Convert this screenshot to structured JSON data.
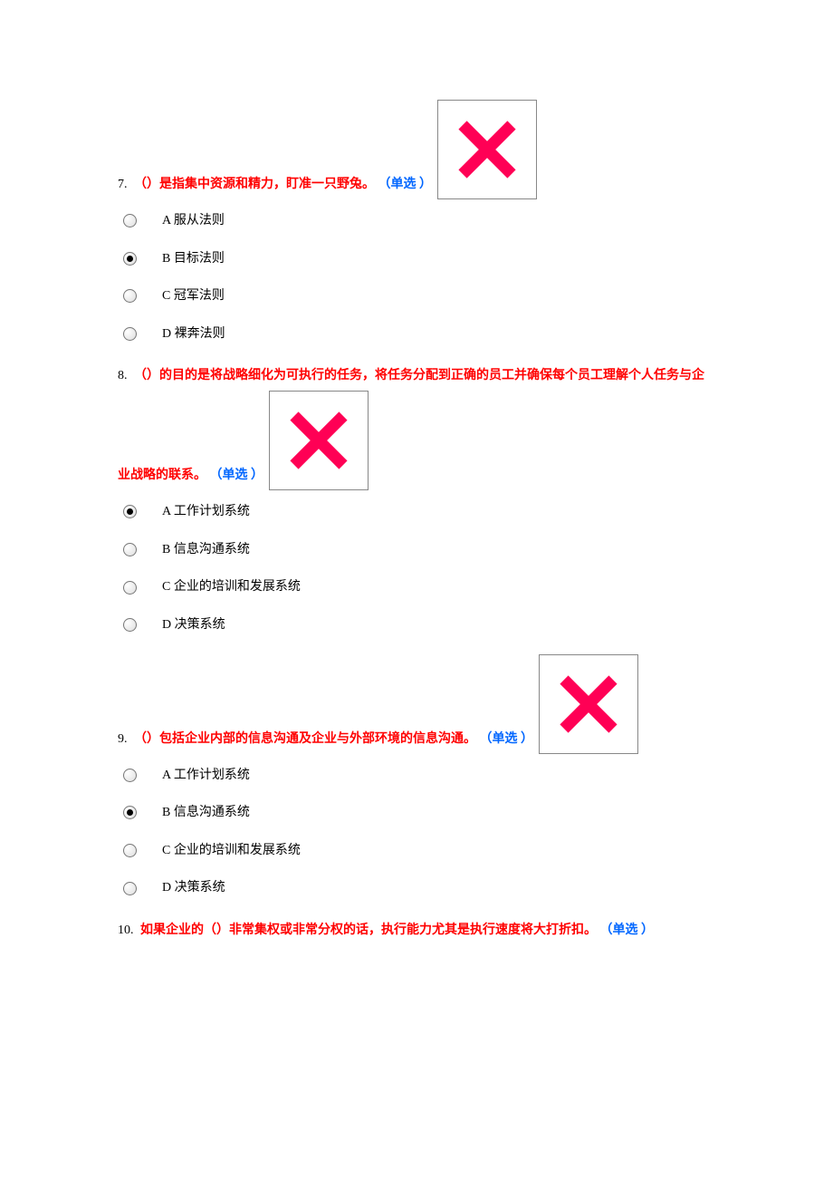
{
  "questions": [
    {
      "num": "7.",
      "text": "（）是指集中资源和精力，盯准一只野兔。",
      "tag": "（单选 ）",
      "mark": "x",
      "options": [
        {
          "label": "A 服从法则",
          "selected": false
        },
        {
          "label": "B 目标法则",
          "selected": true
        },
        {
          "label": "C 冠军法则",
          "selected": false
        },
        {
          "label": "D 裸奔法则",
          "selected": false
        }
      ]
    },
    {
      "num": "8.",
      "text_pre": "（）的目的是将战略细化为可执行的任务，将任务分配到正确的员工并确保每个员工理解个人任务与企",
      "text_post": "业战略的联系。",
      "tag": "（单选 ）",
      "mark": "x",
      "options": [
        {
          "label": "A 工作计划系统",
          "selected": true
        },
        {
          "label": "B 信息沟通系统",
          "selected": false
        },
        {
          "label": "C 企业的培训和发展系统",
          "selected": false
        },
        {
          "label": "D 决策系统",
          "selected": false
        }
      ]
    },
    {
      "num": "9.",
      "text": "（）包括企业内部的信息沟通及企业与外部环境的信息沟通。",
      "tag": "（单选 ）",
      "mark": "x",
      "options": [
        {
          "label": "A 工作计划系统",
          "selected": false
        },
        {
          "label": "B 信息沟通系统",
          "selected": true
        },
        {
          "label": "C 企业的培训和发展系统",
          "selected": false
        },
        {
          "label": "D 决策系统",
          "selected": false
        }
      ]
    },
    {
      "num": "10.",
      "text": "如果企业的（）非常集权或非常分权的话，执行能力尤其是执行速度将大打折扣。",
      "tag": "（单选 ）",
      "mark": null,
      "options": []
    }
  ]
}
